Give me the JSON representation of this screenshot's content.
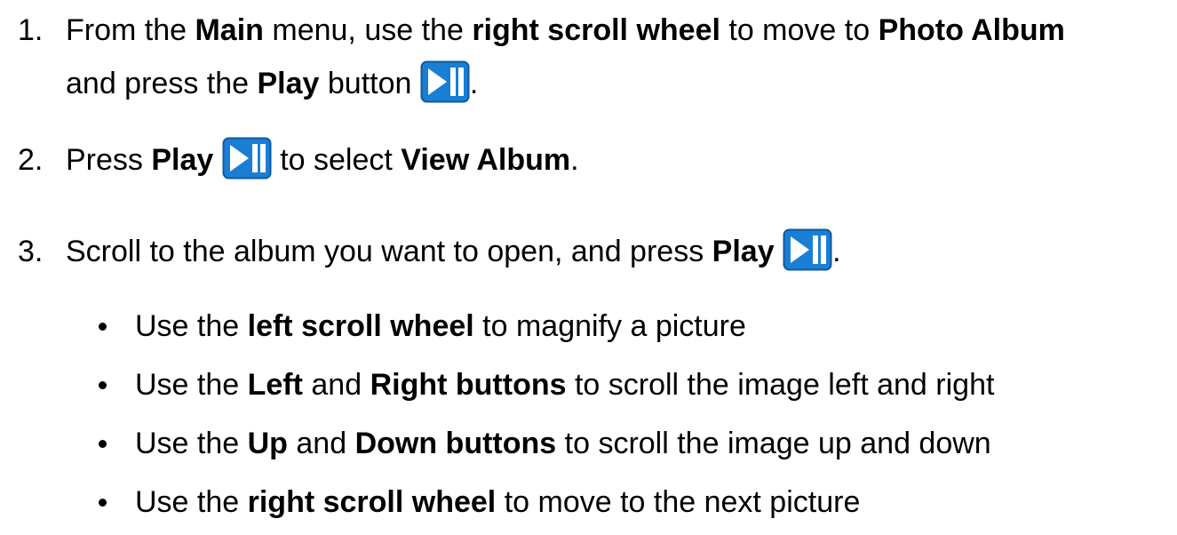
{
  "colors": {
    "play_button_fill": "#1a7fd4",
    "play_button_border": "#0d5aa3",
    "play_button_glyph": "#ffffff"
  },
  "icons": {
    "play_pause": "play-pause-button-icon"
  },
  "steps": [
    {
      "number": "1.",
      "line1": {
        "t1": "From the ",
        "b1": "Main",
        "t2": " menu, use the ",
        "b2": "right scroll wheel",
        "t3": " to move to ",
        "b3": "Photo Album"
      },
      "line2": {
        "t1": "and press the ",
        "b1": "Play",
        "t2": " button ",
        "t3": "."
      }
    },
    {
      "number": "2.",
      "t1": "Press ",
      "b1": "Play",
      "t2": " to select ",
      "b2": "View Album",
      "t3": "."
    },
    {
      "number": "3.",
      "t1": "Scroll to the album you want to open, and press ",
      "b1": "Play",
      "t2": "."
    }
  ],
  "bullets": [
    {
      "t1": "Use the ",
      "b1": "left scroll wheel",
      "t2": " to magnify a picture"
    },
    {
      "t1": "Use the ",
      "b1": "Left",
      "t2": " and ",
      "b2": "Right buttons",
      "t3": " to scroll the image left and right"
    },
    {
      "t1": "Use the ",
      "b1": "Up",
      "t2": " and ",
      "b2": "Down buttons",
      "t3": " to scroll the image up and down"
    },
    {
      "t1": "Use the ",
      "b1": "right scroll wheel",
      "t2": " to move to the next picture"
    }
  ]
}
